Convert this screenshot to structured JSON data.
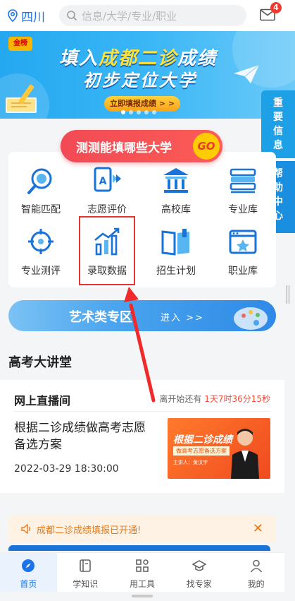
{
  "header": {
    "location": "四川",
    "search_placeholder": "信息/大学/专业/职业",
    "message_count": "4"
  },
  "banner": {
    "logo": "金榜",
    "title_prefix": "填入",
    "title_highlight": "成都二诊",
    "title_suffix": "成绩",
    "subtitle": "初步定位大学",
    "button": "立即填报成绩 > >"
  },
  "side_tabs": {
    "important": "重要信息",
    "help": "帮助中心"
  },
  "cta": {
    "label": "测测能填哪些大学",
    "go": "GO"
  },
  "features": [
    {
      "label": "智能匹配",
      "icon": "magnifier-icon"
    },
    {
      "label": "志愿评价",
      "icon": "document-a-icon"
    },
    {
      "label": "高校库",
      "icon": "university-building-icon"
    },
    {
      "label": "专业库",
      "icon": "books-stack-icon"
    },
    {
      "label": "专业测评",
      "icon": "assessment-target-icon"
    },
    {
      "label": "录取数据",
      "icon": "bar-chart-trend-icon"
    },
    {
      "label": "招生计划",
      "icon": "open-book-icon"
    },
    {
      "label": "职业库",
      "icon": "window-star-icon"
    }
  ],
  "art_zone": {
    "title": "艺术类专区",
    "enter": "进入 >>"
  },
  "lecture": {
    "section_title": "高考大讲堂",
    "live_title": "网上直播间",
    "countdown_prefix": "离开始还有",
    "countdown": "1天7时36分15秒",
    "topic": "根据二诊成绩做高考志愿备选方案",
    "date": "2022-03-29 18:30:00",
    "thumb_title": "根据二诊成绩",
    "thumb_sub": "做高考志愿备选方案",
    "thumb_presenter": "主讲人：黄汉宇"
  },
  "notice": {
    "text": "成都二诊成绩填报已开通!",
    "close": "✕"
  },
  "nav": [
    {
      "label": "首页",
      "icon": "compass-icon",
      "active": true
    },
    {
      "label": "学知识",
      "icon": "book-icon",
      "active": false
    },
    {
      "label": "用工具",
      "icon": "grid-tools-icon",
      "active": false
    },
    {
      "label": "找专家",
      "icon": "graduation-cap-icon",
      "active": false
    },
    {
      "label": "我的",
      "icon": "user-icon",
      "active": false
    }
  ]
}
